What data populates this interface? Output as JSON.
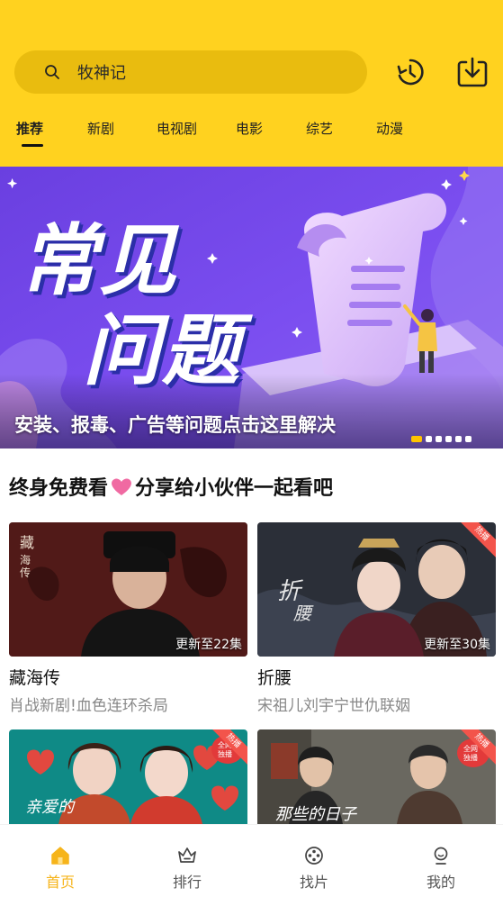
{
  "search": {
    "query": "牧神记"
  },
  "header_icons": [
    "history-icon",
    "download-icon"
  ],
  "tabs": [
    {
      "label": "推荐",
      "active": true
    },
    {
      "label": "新剧",
      "active": false
    },
    {
      "label": "电视剧",
      "active": false
    },
    {
      "label": "电影",
      "active": false
    },
    {
      "label": "综艺",
      "active": false
    },
    {
      "label": "动漫",
      "active": false
    }
  ],
  "banner": {
    "headline_1": "常见",
    "headline_2": "问题",
    "caption": "安装、报毒、广告等问题点击这里解决",
    "slide_count": 6,
    "active_slide": 1
  },
  "share": {
    "before": "终身免费看",
    "after": "分享给小伙伴一起看吧"
  },
  "cards": [
    {
      "title": "藏海传",
      "subtitle": "肖战新剧!血色连环杀局",
      "episodes": "更新至22集",
      "badge": ""
    },
    {
      "title": "折腰",
      "subtitle": "宋祖儿刘宇宁世仇联姻",
      "episodes": "更新至30集",
      "badge": "热播"
    },
    {
      "title": "",
      "subtitle": "",
      "episodes": "",
      "badge": "热播"
    },
    {
      "title": "",
      "subtitle": "",
      "episodes": "",
      "badge": "热播"
    }
  ],
  "bottom_nav": [
    {
      "label": "首页",
      "icon": "home-icon",
      "active": true
    },
    {
      "label": "排行",
      "icon": "crown-icon",
      "active": false
    },
    {
      "label": "找片",
      "icon": "film-reel-icon",
      "active": false
    },
    {
      "label": "我的",
      "icon": "user-icon",
      "active": false
    }
  ],
  "colors": {
    "header": "#ffd21f",
    "accent": "#f6b41a",
    "badge": "#f3544b"
  }
}
